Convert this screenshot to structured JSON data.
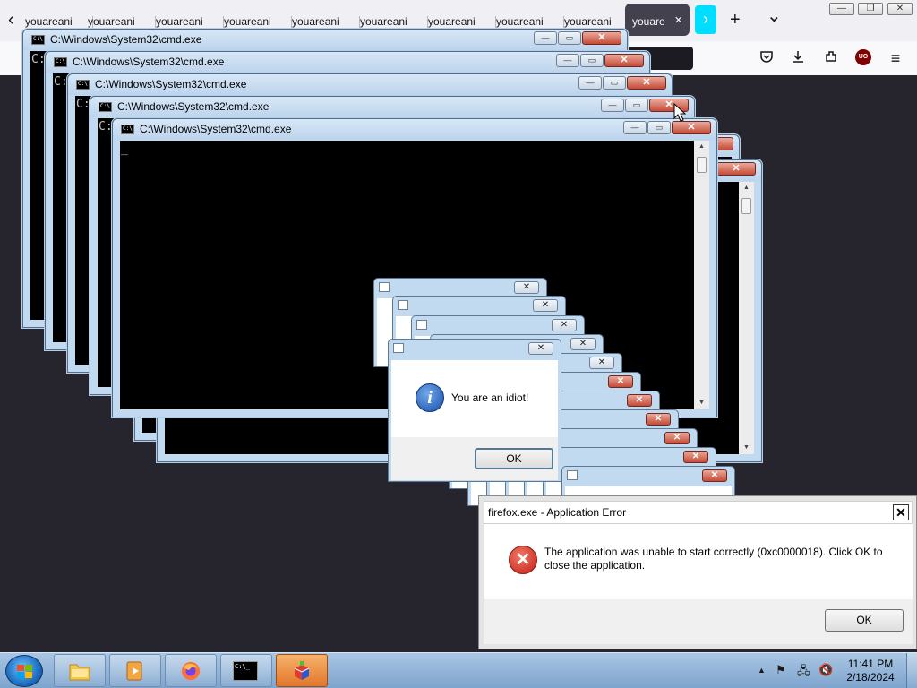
{
  "browser": {
    "tab_title": "youareani",
    "tab_count": 9,
    "active_tab_label": "youare",
    "active_tab_close": "×",
    "new_tab_symbol": "+",
    "list_tabs_symbol": "⌄",
    "window_controls": {
      "minimize": "—",
      "restore": "❐",
      "close": "✕"
    },
    "toolbar": {
      "back": "‹",
      "forward_hint": "›",
      "pocket": "pocket-icon",
      "downloads": "downloads-icon",
      "extensions": "extensions-icon",
      "ublock": "UO",
      "menu": "≡"
    }
  },
  "cmd_windows": {
    "title": "C:\\Windows\\System32\\cmd.exe",
    "prompt": "C:",
    "cursor": "_",
    "minimize": "—",
    "maximize": "▭",
    "close": "✕",
    "scroll_up": "▲",
    "scroll_down": "▼"
  },
  "popup_windows": {
    "close": "✕"
  },
  "idiot_dialog": {
    "message": "You are an idiot!",
    "icon": "i",
    "ok": "OK",
    "close": "✕"
  },
  "error_dialog": {
    "title": "firefox.exe - Application Error",
    "message": "The application was unable to start correctly (0xc0000018). Click OK to close the application.",
    "icon": "✕",
    "ok": "OK",
    "close": "✕"
  },
  "taskbar": {
    "items": [
      "file-explorer",
      "media-player",
      "firefox",
      "command-prompt",
      "app-unknown"
    ],
    "cmd_label": "C:\\_",
    "tray": {
      "show_hidden": "▲",
      "flag": "⚑",
      "network": "🖧",
      "volume_muted": "🔇"
    },
    "time": "11:41 PM",
    "date": "2/18/2024"
  },
  "colors": {
    "desktop": "#26252d",
    "aero_frame": "#c2daf0",
    "close_red": "#c74a37",
    "firefox_accent": "#00ddff",
    "taskbar": "#8fb0d6"
  }
}
